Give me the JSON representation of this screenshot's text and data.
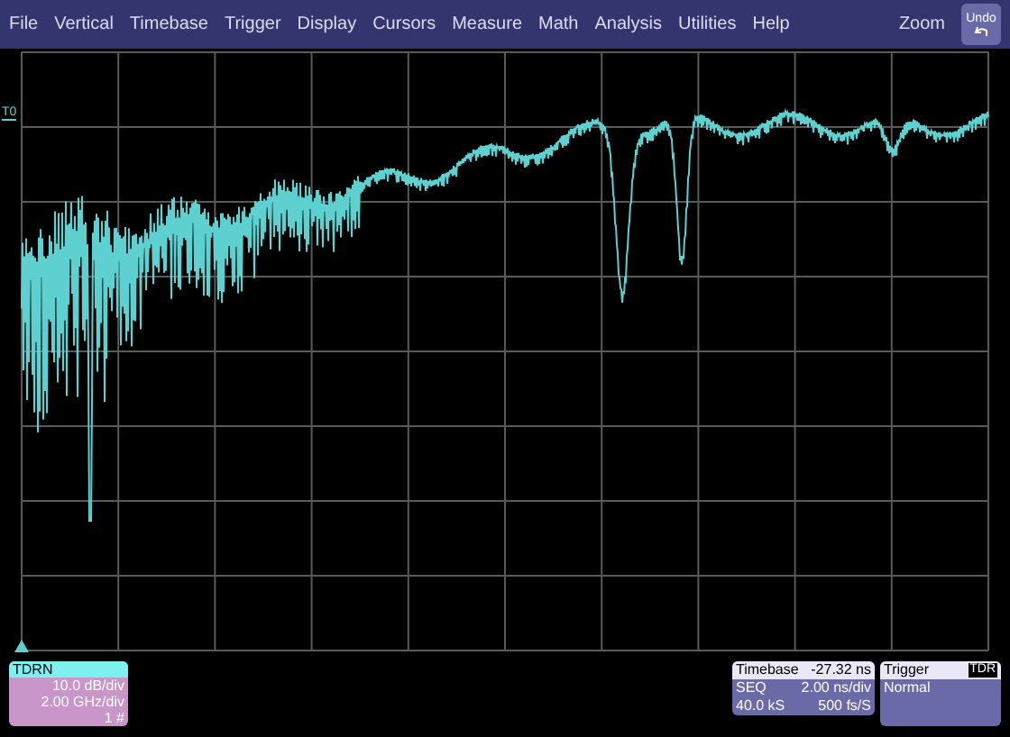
{
  "menu": {
    "items": [
      "File",
      "Vertical",
      "Timebase",
      "Trigger",
      "Display",
      "Cursors",
      "Measure",
      "Math",
      "Analysis",
      "Utilities",
      "Help"
    ],
    "zoom": "Zoom",
    "undo": "Undo"
  },
  "grid": {
    "reference_label": "T0"
  },
  "channel": {
    "label": "TDRN",
    "lines": [
      "10.0 dB/div",
      "2.00 GHz/div",
      "1 #"
    ]
  },
  "timebase": {
    "title": "Timebase",
    "offset": "-27.32 ns",
    "rows": [
      [
        "SEQ",
        "2.00 ns/div"
      ],
      [
        "40.0 kS",
        "500 fs/S"
      ]
    ]
  },
  "trigger": {
    "title": "Trigger",
    "badge": "TDR",
    "mode": "Normal"
  }
}
